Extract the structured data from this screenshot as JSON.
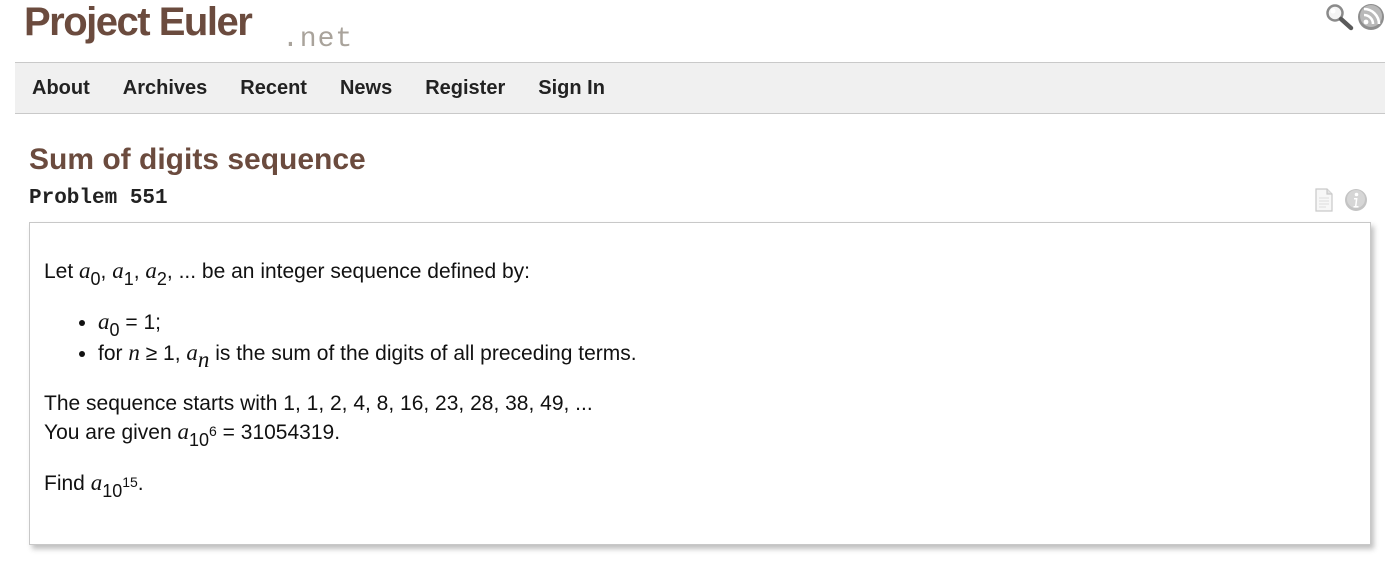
{
  "logo": {
    "main": "Project Euler",
    "suffix": ".net"
  },
  "header_icons": [
    "search-icon",
    "rss-icon"
  ],
  "nav": {
    "items": [
      {
        "label": "About"
      },
      {
        "label": "Archives"
      },
      {
        "label": "Recent"
      },
      {
        "label": "News"
      },
      {
        "label": "Register"
      },
      {
        "label": "Sign In"
      }
    ]
  },
  "problem": {
    "title": "Sum of digits sequence",
    "number_label": "Problem 551",
    "icons": [
      "document-icon",
      "info-icon"
    ],
    "intro": {
      "prefix": "Let ",
      "seq_var": "a",
      "sub0": "0",
      "sub1": "1",
      "sub2": "2",
      "ellipsis": ", ... be an integer sequence defined by:"
    },
    "rule1": {
      "var": "a",
      "sub": "0",
      "rest": " = 1;"
    },
    "rule2": {
      "prefix": "for ",
      "n": "n",
      "cond": " ≥ 1, ",
      "var": "a",
      "sub": "n",
      "rest": " is the sum of the digits of all preceding terms."
    },
    "sequence_start": "The sequence starts with 1, 1, 2, 4, 8, 16, 23, 28, 38, 49, ...",
    "given": {
      "prefix": "You are given ",
      "var": "a",
      "sub_base": "10",
      "sub_exp": "6",
      "rest": " = 31054319."
    },
    "find": {
      "prefix": "Find ",
      "var": "a",
      "sub_base": "10",
      "sub_exp": "15",
      "rest": "."
    }
  },
  "colors": {
    "brand_brown": "#6b4b3e",
    "net_gray": "#a9a39b",
    "nav_bg": "#f0f0f0",
    "border": "#c8c8c8"
  }
}
